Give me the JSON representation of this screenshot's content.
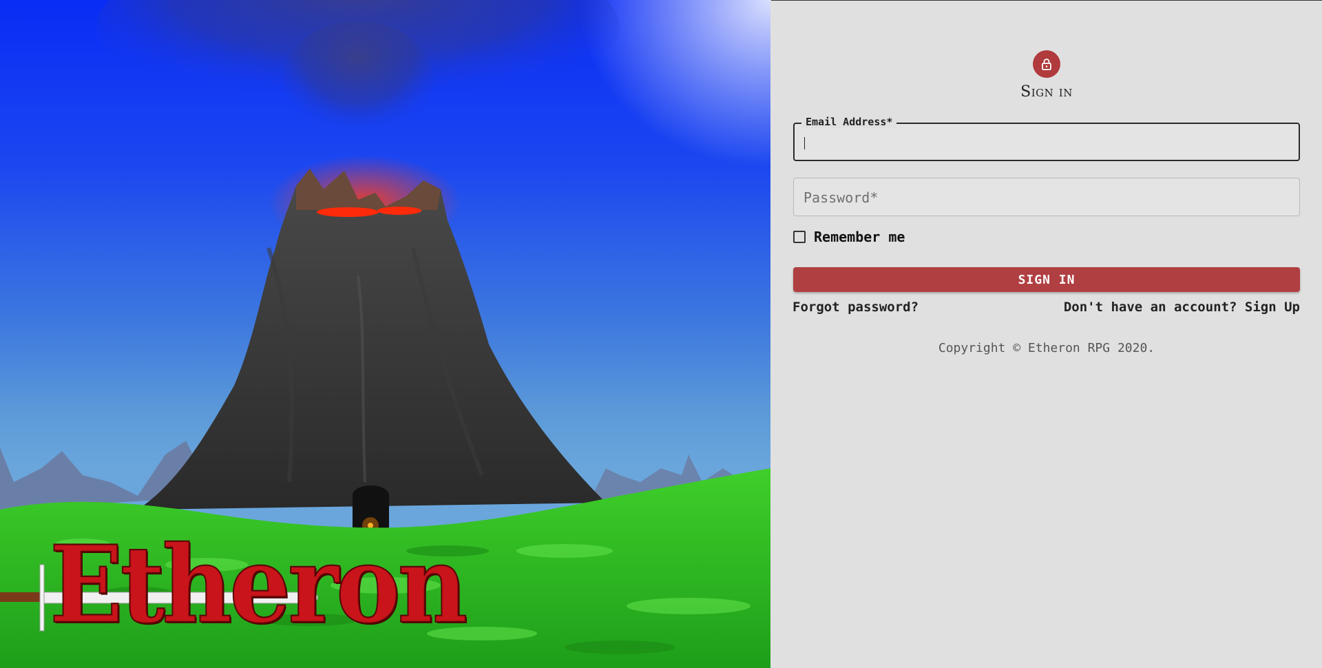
{
  "hero": {
    "logo_text": "Etheron"
  },
  "form": {
    "title": "Sign in",
    "email": {
      "label": "Email Address*",
      "value": ""
    },
    "password": {
      "placeholder": "Password*",
      "value": ""
    },
    "remember_label": "Remember me",
    "remember_checked": false,
    "submit_label": "SIGN IN",
    "forgot_link": "Forgot password?",
    "signup_link": "Don't have an account? Sign Up",
    "copyright": "Copyright © Etheron RPG 2020."
  },
  "colors": {
    "accent": "#b03f41",
    "panel_bg": "#e0e0e0"
  },
  "icons": {
    "avatar_icon": "lock-icon"
  }
}
